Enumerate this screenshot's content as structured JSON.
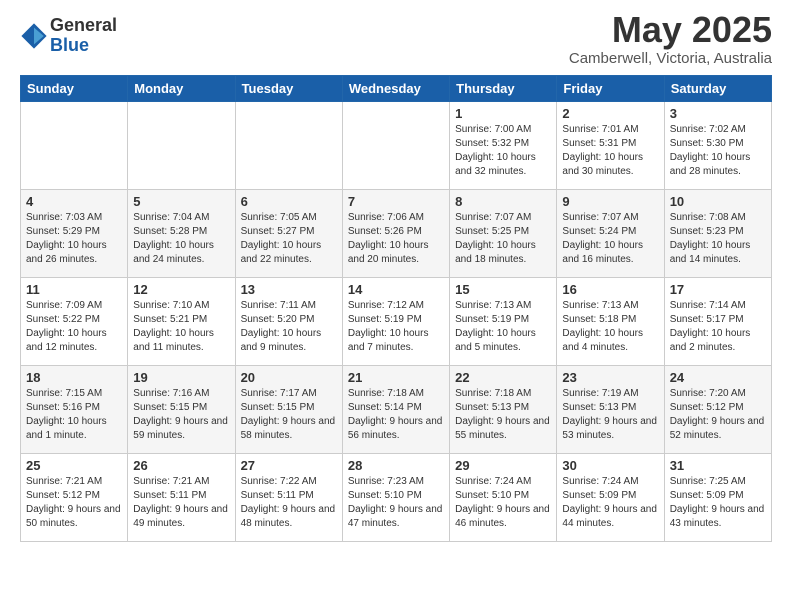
{
  "header": {
    "logo_general": "General",
    "logo_blue": "Blue",
    "month": "May 2025",
    "location": "Camberwell, Victoria, Australia"
  },
  "weekdays": [
    "Sunday",
    "Monday",
    "Tuesday",
    "Wednesday",
    "Thursday",
    "Friday",
    "Saturday"
  ],
  "weeks": [
    [
      {
        "day": "",
        "info": ""
      },
      {
        "day": "",
        "info": ""
      },
      {
        "day": "",
        "info": ""
      },
      {
        "day": "",
        "info": ""
      },
      {
        "day": "1",
        "info": "Sunrise: 7:00 AM\nSunset: 5:32 PM\nDaylight: 10 hours\nand 32 minutes."
      },
      {
        "day": "2",
        "info": "Sunrise: 7:01 AM\nSunset: 5:31 PM\nDaylight: 10 hours\nand 30 minutes."
      },
      {
        "day": "3",
        "info": "Sunrise: 7:02 AM\nSunset: 5:30 PM\nDaylight: 10 hours\nand 28 minutes."
      }
    ],
    [
      {
        "day": "4",
        "info": "Sunrise: 7:03 AM\nSunset: 5:29 PM\nDaylight: 10 hours\nand 26 minutes."
      },
      {
        "day": "5",
        "info": "Sunrise: 7:04 AM\nSunset: 5:28 PM\nDaylight: 10 hours\nand 24 minutes."
      },
      {
        "day": "6",
        "info": "Sunrise: 7:05 AM\nSunset: 5:27 PM\nDaylight: 10 hours\nand 22 minutes."
      },
      {
        "day": "7",
        "info": "Sunrise: 7:06 AM\nSunset: 5:26 PM\nDaylight: 10 hours\nand 20 minutes."
      },
      {
        "day": "8",
        "info": "Sunrise: 7:07 AM\nSunset: 5:25 PM\nDaylight: 10 hours\nand 18 minutes."
      },
      {
        "day": "9",
        "info": "Sunrise: 7:07 AM\nSunset: 5:24 PM\nDaylight: 10 hours\nand 16 minutes."
      },
      {
        "day": "10",
        "info": "Sunrise: 7:08 AM\nSunset: 5:23 PM\nDaylight: 10 hours\nand 14 minutes."
      }
    ],
    [
      {
        "day": "11",
        "info": "Sunrise: 7:09 AM\nSunset: 5:22 PM\nDaylight: 10 hours\nand 12 minutes."
      },
      {
        "day": "12",
        "info": "Sunrise: 7:10 AM\nSunset: 5:21 PM\nDaylight: 10 hours\nand 11 minutes."
      },
      {
        "day": "13",
        "info": "Sunrise: 7:11 AM\nSunset: 5:20 PM\nDaylight: 10 hours\nand 9 minutes."
      },
      {
        "day": "14",
        "info": "Sunrise: 7:12 AM\nSunset: 5:19 PM\nDaylight: 10 hours\nand 7 minutes."
      },
      {
        "day": "15",
        "info": "Sunrise: 7:13 AM\nSunset: 5:19 PM\nDaylight: 10 hours\nand 5 minutes."
      },
      {
        "day": "16",
        "info": "Sunrise: 7:13 AM\nSunset: 5:18 PM\nDaylight: 10 hours\nand 4 minutes."
      },
      {
        "day": "17",
        "info": "Sunrise: 7:14 AM\nSunset: 5:17 PM\nDaylight: 10 hours\nand 2 minutes."
      }
    ],
    [
      {
        "day": "18",
        "info": "Sunrise: 7:15 AM\nSunset: 5:16 PM\nDaylight: 10 hours\nand 1 minute."
      },
      {
        "day": "19",
        "info": "Sunrise: 7:16 AM\nSunset: 5:15 PM\nDaylight: 9 hours\nand 59 minutes."
      },
      {
        "day": "20",
        "info": "Sunrise: 7:17 AM\nSunset: 5:15 PM\nDaylight: 9 hours\nand 58 minutes."
      },
      {
        "day": "21",
        "info": "Sunrise: 7:18 AM\nSunset: 5:14 PM\nDaylight: 9 hours\nand 56 minutes."
      },
      {
        "day": "22",
        "info": "Sunrise: 7:18 AM\nSunset: 5:13 PM\nDaylight: 9 hours\nand 55 minutes."
      },
      {
        "day": "23",
        "info": "Sunrise: 7:19 AM\nSunset: 5:13 PM\nDaylight: 9 hours\nand 53 minutes."
      },
      {
        "day": "24",
        "info": "Sunrise: 7:20 AM\nSunset: 5:12 PM\nDaylight: 9 hours\nand 52 minutes."
      }
    ],
    [
      {
        "day": "25",
        "info": "Sunrise: 7:21 AM\nSunset: 5:12 PM\nDaylight: 9 hours\nand 50 minutes."
      },
      {
        "day": "26",
        "info": "Sunrise: 7:21 AM\nSunset: 5:11 PM\nDaylight: 9 hours\nand 49 minutes."
      },
      {
        "day": "27",
        "info": "Sunrise: 7:22 AM\nSunset: 5:11 PM\nDaylight: 9 hours\nand 48 minutes."
      },
      {
        "day": "28",
        "info": "Sunrise: 7:23 AM\nSunset: 5:10 PM\nDaylight: 9 hours\nand 47 minutes."
      },
      {
        "day": "29",
        "info": "Sunrise: 7:24 AM\nSunset: 5:10 PM\nDaylight: 9 hours\nand 46 minutes."
      },
      {
        "day": "30",
        "info": "Sunrise: 7:24 AM\nSunset: 5:09 PM\nDaylight: 9 hours\nand 44 minutes."
      },
      {
        "day": "31",
        "info": "Sunrise: 7:25 AM\nSunset: 5:09 PM\nDaylight: 9 hours\nand 43 minutes."
      }
    ]
  ]
}
